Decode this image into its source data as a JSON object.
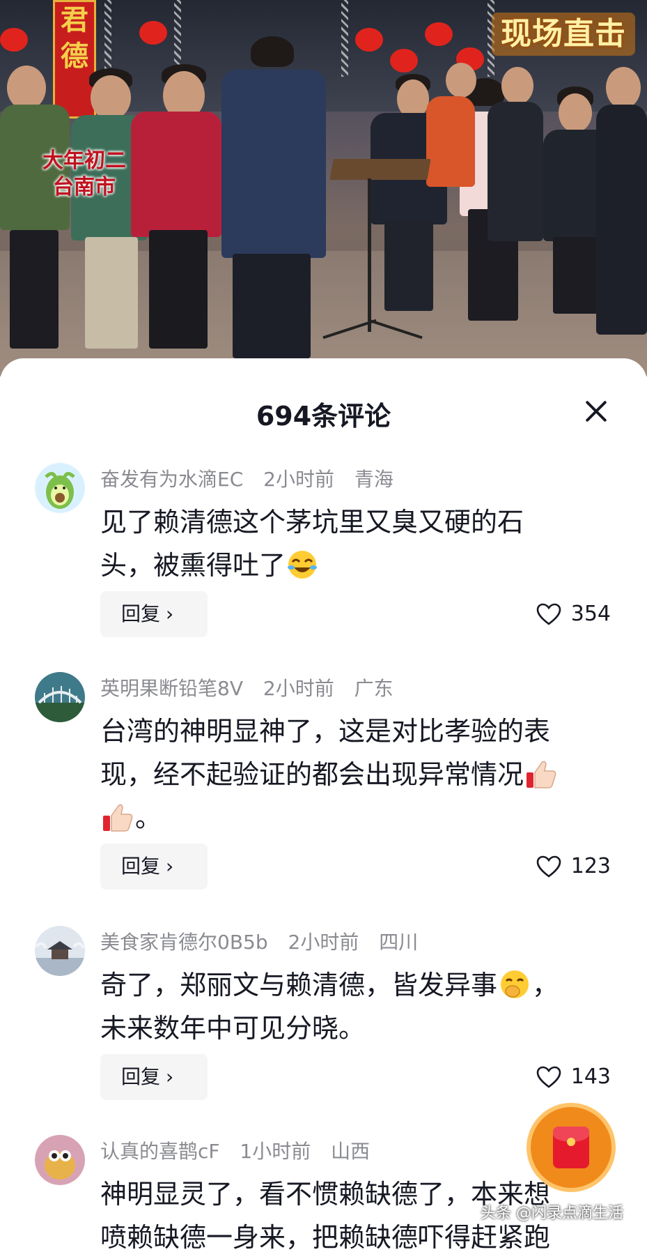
{
  "video": {
    "overlay_left_line1": "大年初二",
    "overlay_left_line2": "台南市",
    "overlay_right": "现场直击",
    "banner_chars": [
      "君",
      "德"
    ]
  },
  "sheet": {
    "title": "694条评论"
  },
  "comments": [
    {
      "username": "奋发有为水滴EC",
      "time": "2小时前",
      "location": "青海",
      "text_line1": "见了赖清德这个茅坑里又臭又硬的石",
      "text_line2": "头，被熏得吐了",
      "emoji": "laughing-crying",
      "reply_label": "回复",
      "likes": "354"
    },
    {
      "username": "英明果断铅笔8V",
      "time": "2小时前",
      "location": "广东",
      "text_line1": "台湾的神明显神了，这是对比孝验的表",
      "text_line2": "现，经不起验证的都会出现异常情况",
      "text_line3": "。",
      "emoji": "thumbs-up",
      "reply_label": "回复",
      "likes": "123"
    },
    {
      "username": "美食家肯德尔0B5b",
      "time": "2小时前",
      "location": "四川",
      "text_line1": "奇了，郑丽文与赖清德，皆发异事",
      "text_line1_tail": "，",
      "text_line2": "未来数年中可见分晓。",
      "emoji": "hand-over-mouth",
      "reply_label": "回复",
      "likes": "143"
    },
    {
      "username": "认真的喜鹊cF",
      "time": "1小时前",
      "location": "山西",
      "text_line1": "神明显灵了，看不惯赖缺德了，本来想",
      "text_line2": "喷赖缺德一身来，把赖缺德吓得赶紧跑"
    }
  ],
  "watermark": "头条 @闪录点滴生活",
  "colors": {
    "meta_gray": "#8a8b91",
    "text_dark": "#161823",
    "reply_bg": "#f5f5f6",
    "float_orange": "#f08a1b"
  }
}
